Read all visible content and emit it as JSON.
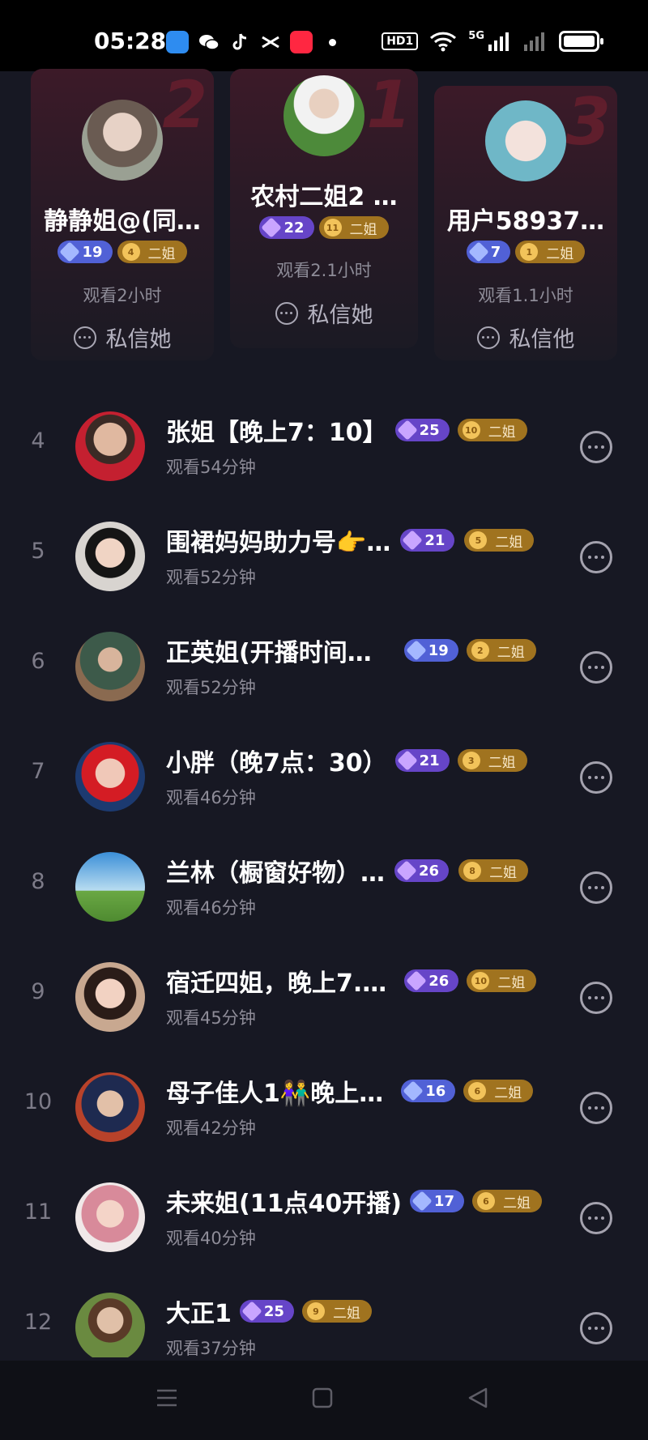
{
  "status_bar": {
    "time": "05:28",
    "network": "HD1",
    "signal": "5G",
    "app_icons": [
      {
        "name": "app-icon-1",
        "color": "#2e8cf0"
      },
      {
        "name": "wechat-icon",
        "color": "#ffffff"
      },
      {
        "name": "tiktok-icon",
        "color": "#ffffff"
      },
      {
        "name": "capcut-icon",
        "color": "#ffffff"
      },
      {
        "name": "xiaohongshu-icon",
        "color": "#ff2741"
      }
    ]
  },
  "top3": [
    {
      "rank": "2",
      "name": "静静姐@(同…",
      "level": "19",
      "level_color": "blue",
      "fan_num": "4",
      "fan_label": "二姐",
      "watch": "观看2小时",
      "action": "私信她"
    },
    {
      "rank": "1",
      "name": "农村二姐2 …",
      "level": "22",
      "level_color": "purple",
      "fan_num": "11",
      "fan_label": "二姐",
      "watch": "观看2.1小时",
      "action": "私信她"
    },
    {
      "rank": "3",
      "name": "用户58937…",
      "level": "7",
      "level_color": "blue",
      "fan_num": "1",
      "fan_label": "二姐",
      "watch": "观看1.1小时",
      "action": "私信他"
    }
  ],
  "list": [
    {
      "rank": "4",
      "name": "张姐【晚上7：10】",
      "level": "25",
      "level_color": "purple",
      "fan_num": "10",
      "fan_label": "二姐",
      "watch": "观看54分钟"
    },
    {
      "rank": "5",
      "name": "围裙妈妈助力号👉…",
      "level": "21",
      "level_color": "purple",
      "fan_num": "5",
      "fan_label": "二姐",
      "watch": "观看52分钟"
    },
    {
      "rank": "6",
      "name": "正英姐(开播时间…",
      "level": "19",
      "level_color": "blue",
      "fan_num": "2",
      "fan_label": "二姐",
      "watch": "观看52分钟"
    },
    {
      "rank": "7",
      "name": "小胖（晚7点：30）",
      "level": "21",
      "level_color": "purple",
      "fan_num": "3",
      "fan_label": "二姐",
      "watch": "观看46分钟"
    },
    {
      "rank": "8",
      "name": "兰林（橱窗好物）…",
      "level": "26",
      "level_color": "purple",
      "fan_num": "8",
      "fan_label": "二姐",
      "watch": "观看46分钟"
    },
    {
      "rank": "9",
      "name": "宿迁四姐，晚上7.…",
      "level": "26",
      "level_color": "purple",
      "fan_num": "10",
      "fan_label": "二姐",
      "watch": "观看45分钟"
    },
    {
      "rank": "10",
      "name": "母子佳人1👫晚上…",
      "level": "16",
      "level_color": "blue",
      "fan_num": "6",
      "fan_label": "二姐",
      "watch": "观看42分钟"
    },
    {
      "rank": "11",
      "name": "未来姐(11点40开播)",
      "level": "17",
      "level_color": "blue",
      "fan_num": "6",
      "fan_label": "二姐",
      "watch": "观看40分钟"
    },
    {
      "rank": "12",
      "name": "大正1",
      "level": "25",
      "level_color": "purple",
      "fan_num": "9",
      "fan_label": "二姐",
      "watch": "观看37分钟"
    }
  ],
  "nav": {
    "menu": "menu-icon",
    "home": "home-icon",
    "back": "back-icon"
  }
}
